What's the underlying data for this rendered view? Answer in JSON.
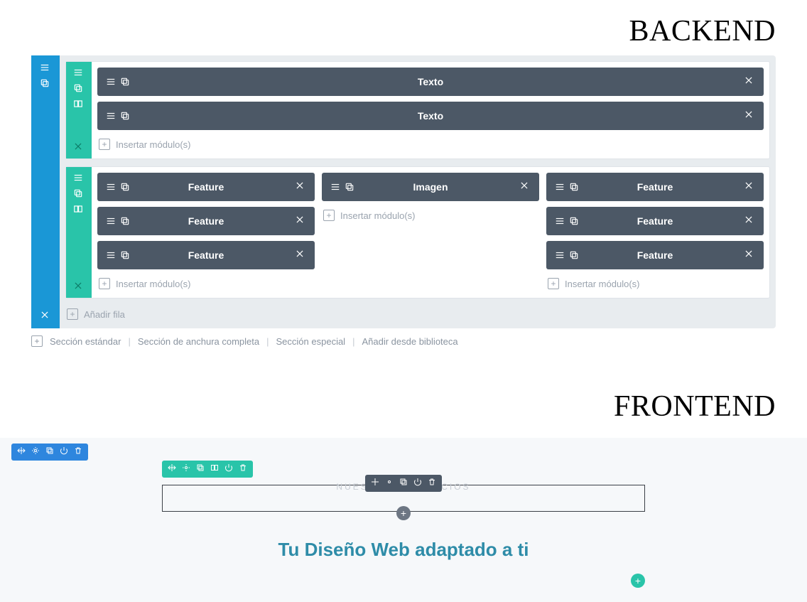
{
  "labels": {
    "backend": "BACKEND",
    "frontend": "FRONTEND"
  },
  "backend": {
    "rows": [
      {
        "layout": "full",
        "columns": [
          {
            "modules": [
              "Texto",
              "Texto"
            ],
            "insert": "Insertar módulo(s)"
          }
        ]
      },
      {
        "layout": "thirds",
        "columns": [
          {
            "modules": [
              "Feature",
              "Feature",
              "Feature"
            ],
            "insert": "Insertar módulo(s)"
          },
          {
            "modules": [
              "Imagen"
            ],
            "insert": "Insertar módulo(s)"
          },
          {
            "modules": [
              "Feature",
              "Feature",
              "Feature"
            ],
            "insert": "Insertar módulo(s)"
          }
        ]
      }
    ],
    "add_row": "Añadir fila",
    "footer": {
      "standard": "Sección estándar",
      "fullwidth": "Sección de anchura completa",
      "special": "Sección especial",
      "from_library": "Añadir desde biblioteca"
    }
  },
  "frontend": {
    "ghost_label": "NUESTROS SERVICIOS",
    "headline": "Tu Diseño Web adaptado a ti"
  }
}
